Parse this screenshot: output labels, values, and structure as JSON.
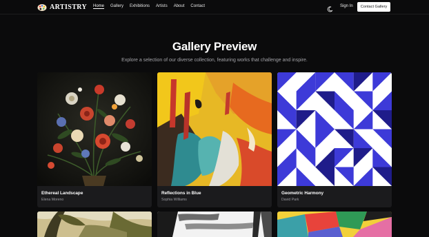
{
  "brand": {
    "name": "ARTISTRY",
    "logo_icon": "palette-icon"
  },
  "nav": {
    "items": [
      {
        "label": "Home",
        "active": true
      },
      {
        "label": "Gallery",
        "active": false
      },
      {
        "label": "Exhibitions",
        "active": false
      },
      {
        "label": "Artists",
        "active": false
      },
      {
        "label": "About",
        "active": false
      },
      {
        "label": "Contact",
        "active": false
      }
    ],
    "theme_icon": "moon-icon",
    "signin_label": "Sign In",
    "contact_label": "Contact Gallery"
  },
  "hero": {
    "title": "Gallery Preview",
    "subtitle": "Explore a selection of our diverse collection, featuring works that challenge and inspire."
  },
  "artworks": [
    {
      "title": "Ethereal Landscape",
      "artist": "Elena Moreno"
    },
    {
      "title": "Reflections in Blue",
      "artist": "Sophia Williams"
    },
    {
      "title": "Geometric Harmony",
      "artist": "David Park"
    }
  ],
  "colors": {
    "background": "#0b0b0c",
    "card": "#1b1b1d",
    "accent": "#3b3bd8",
    "button": "#ffffff"
  }
}
